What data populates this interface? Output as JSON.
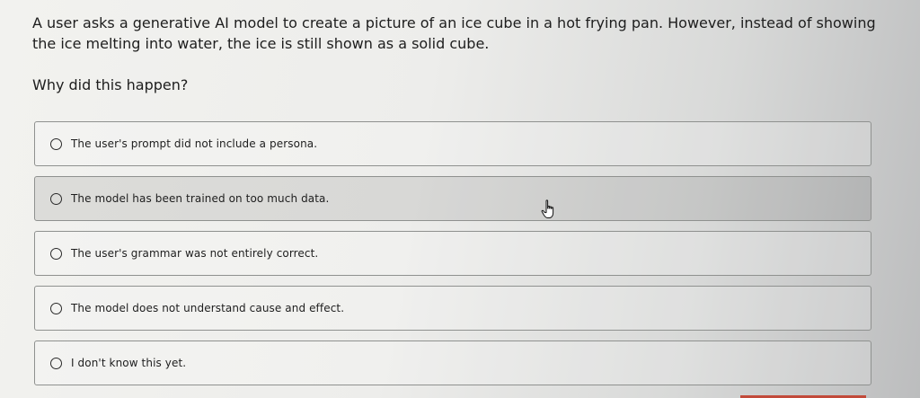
{
  "question": {
    "text": "A user asks a generative AI model to create a picture of an ice cube in a hot frying pan. However, instead of showing the ice melting into water, the ice is still shown as a solid cube.",
    "prompt": "Why did this happen?"
  },
  "options": [
    {
      "label": "The user's prompt did not include a persona."
    },
    {
      "label": "The model has been trained on too much data."
    },
    {
      "label": "The user's grammar was not entirely correct."
    },
    {
      "label": "The model does not understand cause and effect."
    },
    {
      "label": "I don't know this yet."
    }
  ],
  "cursor": {
    "icon": "hand-pointer-icon"
  },
  "colors": {
    "accent": "#c24a3a",
    "border": "#8f918f"
  }
}
